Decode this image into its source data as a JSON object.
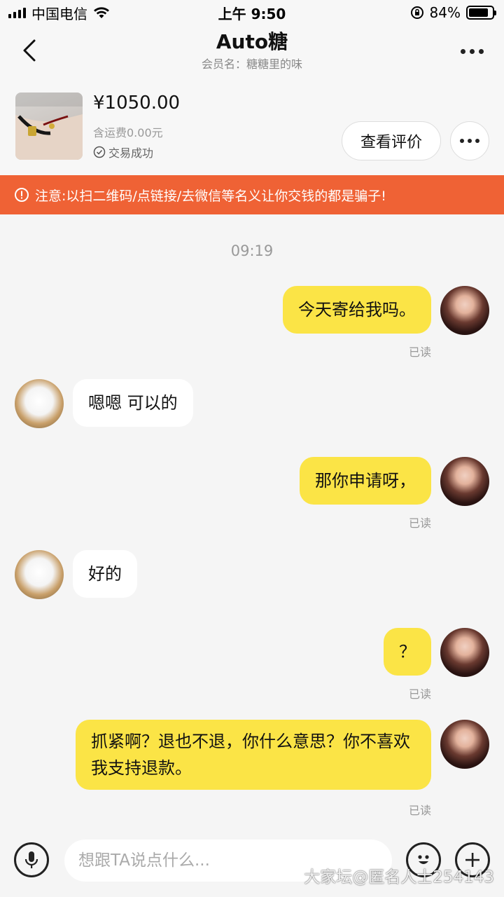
{
  "status_bar": {
    "carrier": "中国电信",
    "time": "上午 9:50",
    "battery_text": "84%",
    "battery_level": 0.84
  },
  "header": {
    "title": "Auto糖",
    "subtitle": "会员名：糖糖里的味"
  },
  "product": {
    "price": "¥1050.00",
    "shipping": "含运费0.00元",
    "status": "交易成功",
    "review_button": "查看评价"
  },
  "warning": {
    "text": "注意:以扫二维码/点链接/去微信等名义让你交钱的都是骗子!"
  },
  "chat": {
    "timestamp": "09:19",
    "messages": [
      {
        "from": "self",
        "text": "今天寄给我吗。",
        "read": "已读"
      },
      {
        "from": "other",
        "text": "嗯嗯 可以的"
      },
      {
        "from": "self",
        "text": "那你申请呀，",
        "read": "已读"
      },
      {
        "from": "other",
        "text": "好的"
      },
      {
        "from": "self",
        "text": "？",
        "read": "已读"
      },
      {
        "from": "self",
        "text": "抓紧啊？退也不退，你什么意思？你不喜欢我支持退款。",
        "read": "已读"
      }
    ]
  },
  "input": {
    "placeholder": "想跟TA说点什么..."
  },
  "icons": {
    "back": "chevron-left-icon",
    "more": "more-icon",
    "mic": "microphone-icon",
    "emoji": "emoji-icon",
    "plus": "plus-icon",
    "warning": "alert-circle-icon",
    "check": "check-circle-icon"
  },
  "colors": {
    "warning_bg": "#ef6235",
    "self_bubble": "#fbe446",
    "other_bubble": "#ffffff"
  },
  "watermark": "大家坛@匿名人士254143"
}
